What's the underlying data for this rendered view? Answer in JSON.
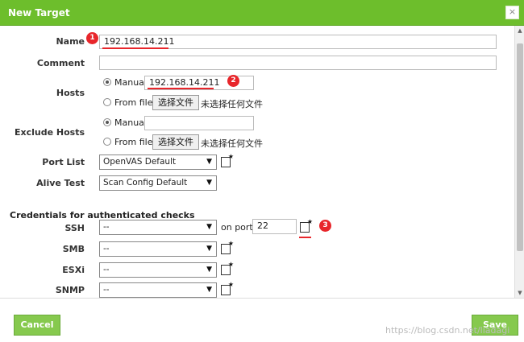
{
  "dialog": {
    "title": "New Target",
    "close_label": "×"
  },
  "fields": {
    "name": {
      "label": "Name",
      "value": "192.168.14.211"
    },
    "comment": {
      "label": "Comment",
      "value": ""
    },
    "hosts": {
      "label": "Hosts",
      "manual_label": "Manual",
      "manual_value": "192.168.14.211",
      "from_file_label": "From file",
      "file_button": "选择文件",
      "no_file_text": "未选择任何文件"
    },
    "exclude_hosts": {
      "label": "Exclude Hosts",
      "manual_label": "Manual",
      "manual_value": "",
      "from_file_label": "From file",
      "file_button": "选择文件",
      "no_file_text": "未选择任何文件"
    },
    "port_list": {
      "label": "Port List",
      "value": "OpenVAS Default"
    },
    "alive_test": {
      "label": "Alive Test",
      "value": "Scan Config Default"
    }
  },
  "credentials": {
    "section_title": "Credentials for authenticated checks",
    "ssh": {
      "label": "SSH",
      "value": "--",
      "on_port_label": "on port",
      "port": "22"
    },
    "smb": {
      "label": "SMB",
      "value": "--"
    },
    "esxi": {
      "label": "ESXi",
      "value": "--"
    },
    "snmp": {
      "label": "SNMP",
      "value": "--"
    }
  },
  "markers": [
    "1",
    "2",
    "3"
  ],
  "footer": {
    "cancel": "Cancel",
    "save": "Save"
  },
  "watermark": "https://blog.csdn.net/liadagi",
  "colors": {
    "header": "#6dbe2c",
    "button": "#86c94e",
    "marker": "#e8262b"
  }
}
